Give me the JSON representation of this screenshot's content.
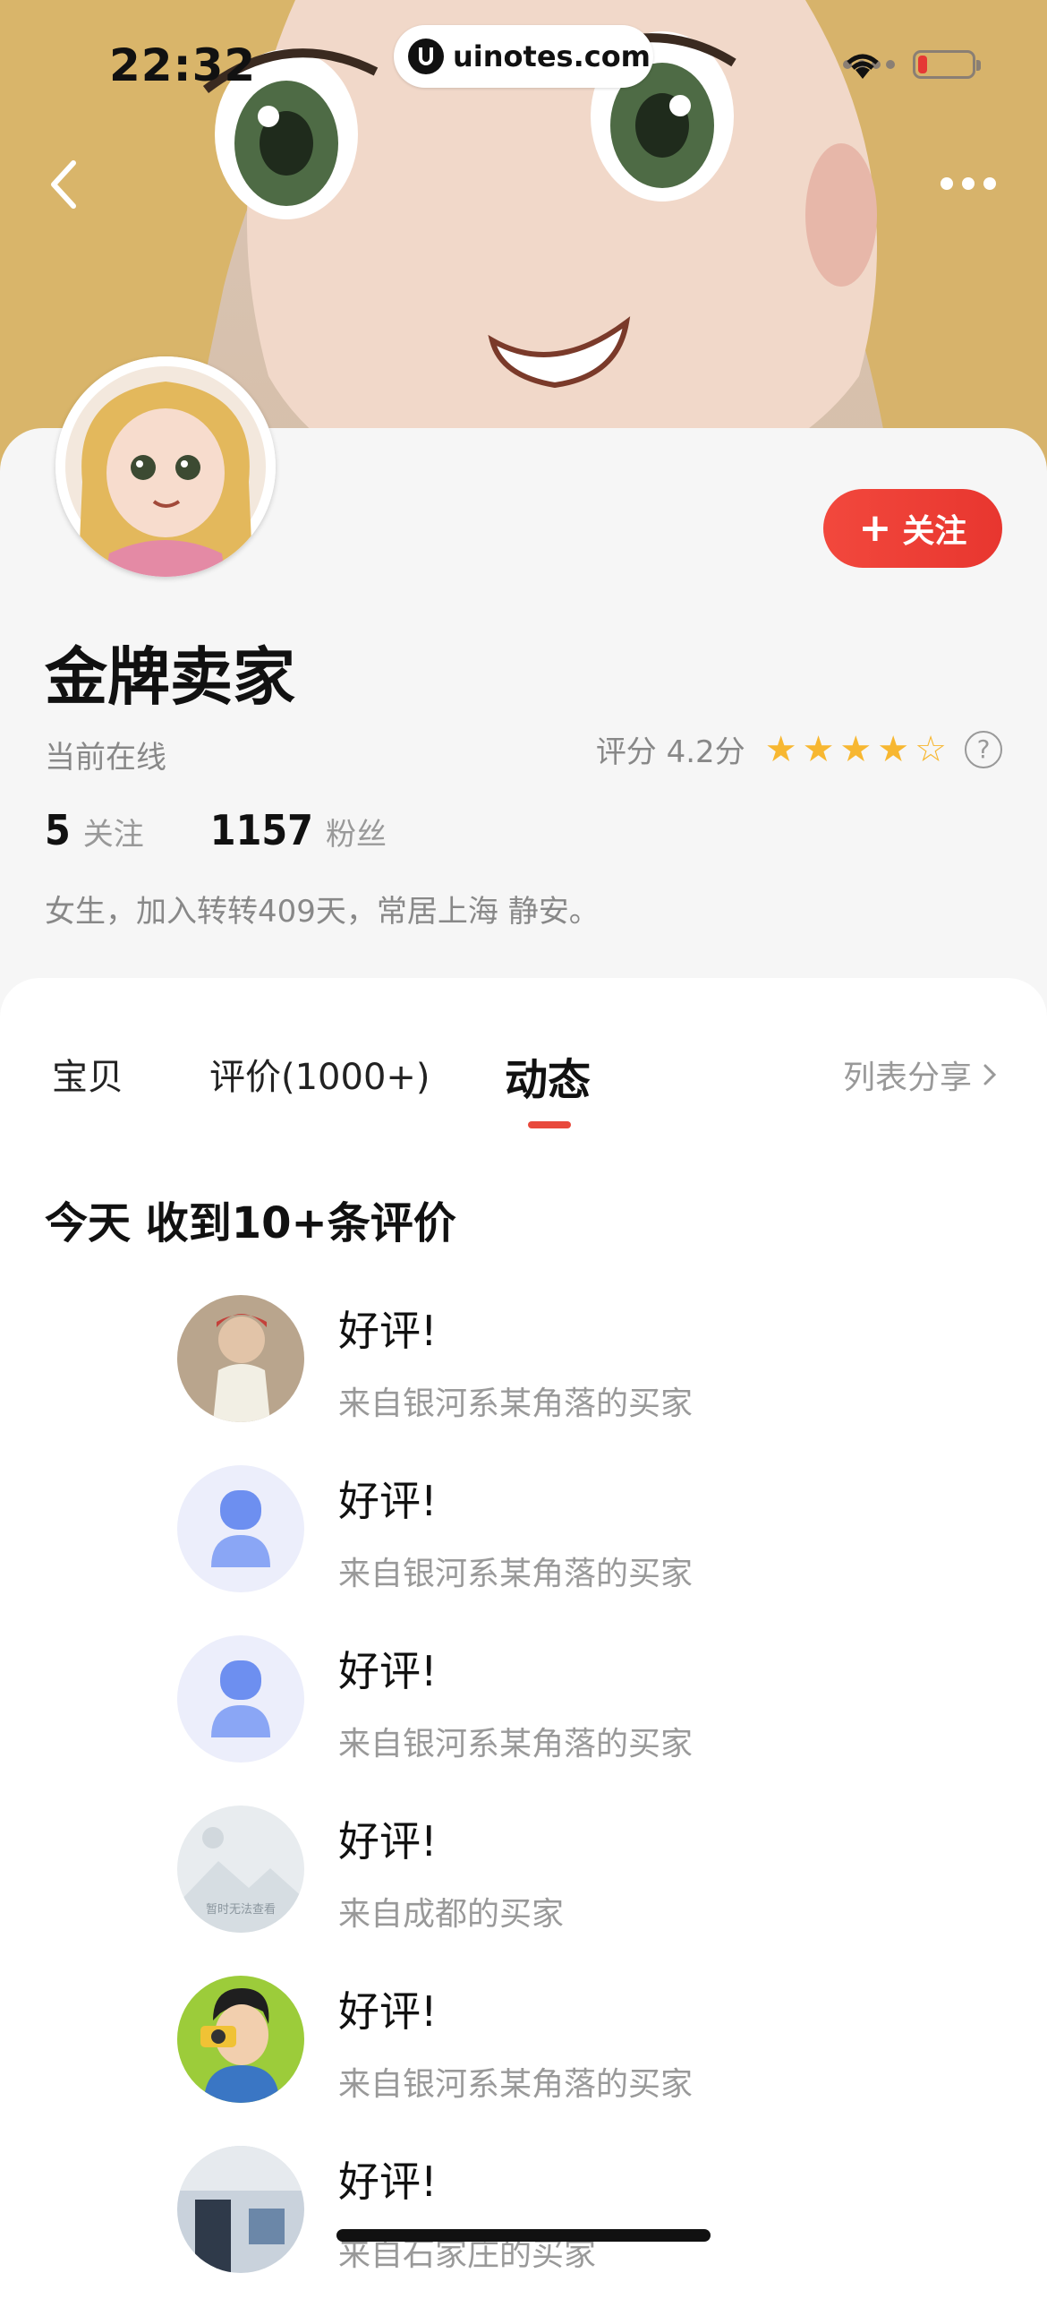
{
  "status_bar": {
    "time": "22:32",
    "url": "uinotes.com"
  },
  "nav": {
    "back_icon": "chevron-left-icon",
    "more_icon": "more-horizontal-icon"
  },
  "profile": {
    "name": "金牌卖家",
    "online_status": "当前在线",
    "rating_label": "评分 4.2分",
    "rating_value": 4.2,
    "stars_filled": 4,
    "stars_total": 5,
    "following_count": "5",
    "following_label": "关注",
    "followers_count": "1157",
    "followers_label": "粉丝",
    "bio": "女生，加入转转409天，常居上海 静安。",
    "follow_button": "关注"
  },
  "tabs": [
    {
      "label": "宝贝",
      "active": false
    },
    {
      "label": "评价(1000+)",
      "active": false
    },
    {
      "label": "动态",
      "active": true
    }
  ],
  "share_label": "列表分享",
  "section_title": "今天 收到10+条评价",
  "reviews": [
    {
      "title": "好评!",
      "source": "来自银河系某角落的买家",
      "avatar": "photo"
    },
    {
      "title": "好评!",
      "source": "来自银河系某角落的买家",
      "avatar": "default"
    },
    {
      "title": "好评!",
      "source": "来自银河系某角落的买家",
      "avatar": "default"
    },
    {
      "title": "好评!",
      "source": "来自成都的买家",
      "avatar": "placeholder",
      "avatar_text": "暂时无法查看"
    },
    {
      "title": "好评!",
      "source": "来自银河系某角落的买家",
      "avatar": "cartoon"
    },
    {
      "title": "好评!",
      "source": "来自石家庄的买家",
      "avatar": "photo2"
    }
  ],
  "colors": {
    "accent": "#e8493c",
    "star": "#f7b731",
    "muted_text": "#999999"
  }
}
